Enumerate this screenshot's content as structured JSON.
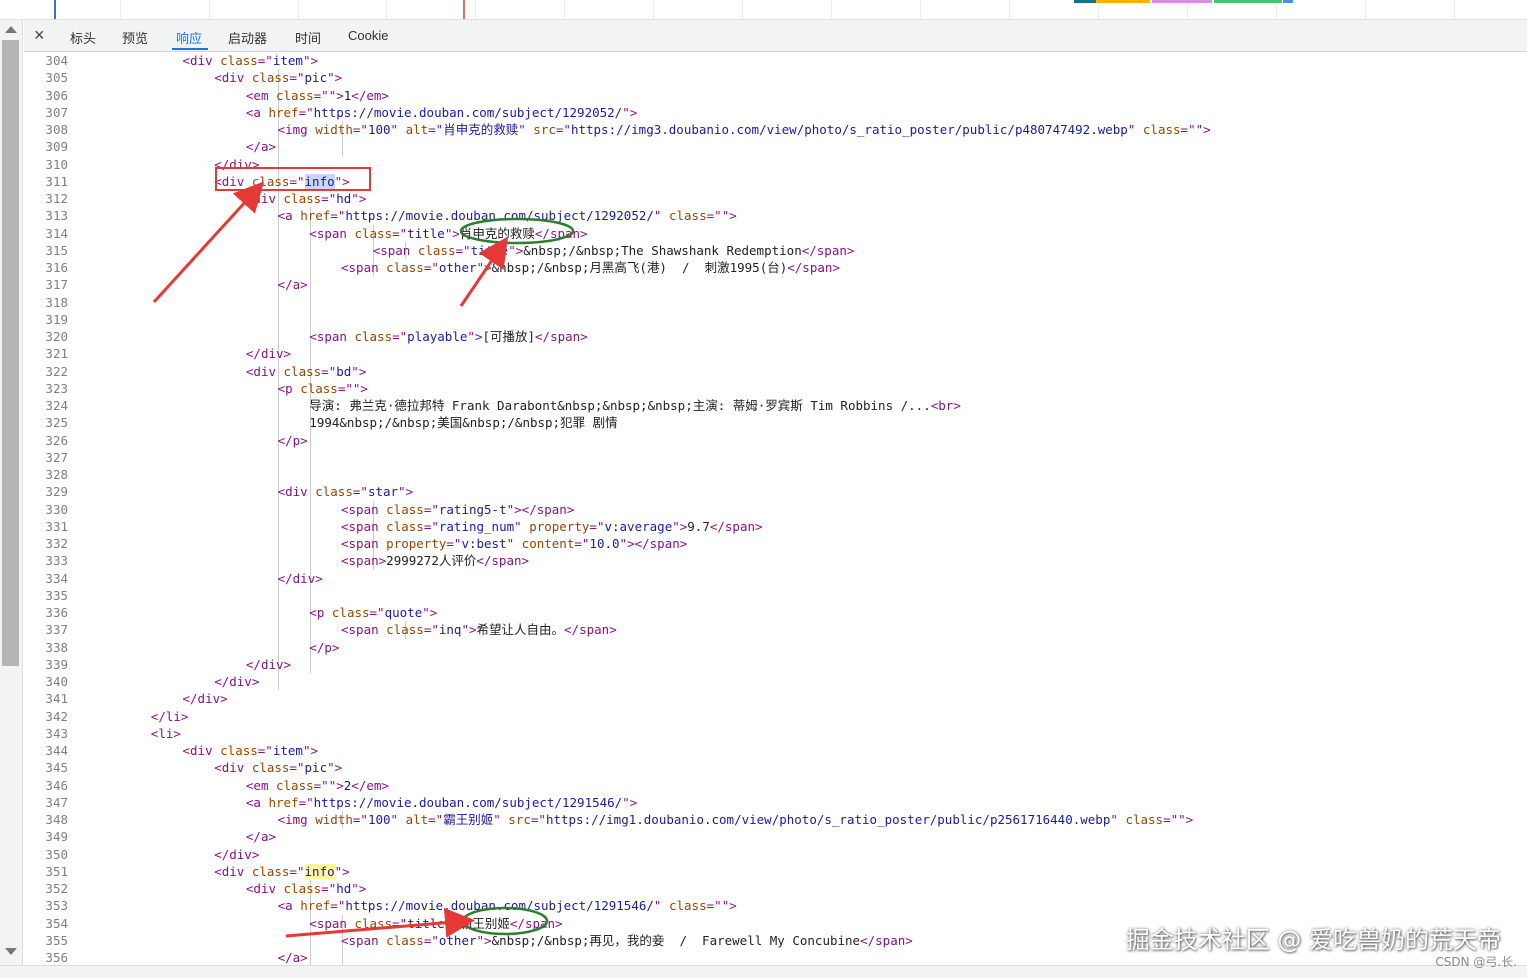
{
  "tabs": {
    "close_icon": "×",
    "items": [
      "标头",
      "预览",
      "响应",
      "启动器",
      "时间",
      "Cookie"
    ],
    "active_index": 2
  },
  "colors": {
    "tag": "#881280",
    "attr": "#994500",
    "value": "#1a1aa6",
    "text": "#222222",
    "annotation_red": "#e53935",
    "annotation_green": "#2e7d32"
  },
  "code_lines": [
    {
      "n": "304",
      "indent": 5,
      "code": "<div class=\"item\">"
    },
    {
      "n": "305",
      "indent": 6,
      "code": "<div class=\"pic\">"
    },
    {
      "n": "306",
      "indent": 7,
      "code": "<em class=\"\">1</em>"
    },
    {
      "n": "307",
      "indent": 7,
      "code": "<a href=\"https://movie.douban.com/subject/1292052/\">"
    },
    {
      "n": "308",
      "indent": 8,
      "code": "<img width=\"100\" alt=\"肖申克的救赎\" src=\"https://img3.doubanio.com/view/photo/s_ratio_poster/public/p480747492.webp\" class=\"\">"
    },
    {
      "n": "309",
      "indent": 7,
      "code": "</a>"
    },
    {
      "n": "310",
      "indent": 6,
      "code": "</div>"
    },
    {
      "n": "311",
      "indent": 6,
      "code": "<div class=\"info\">",
      "mark": "sel"
    },
    {
      "n": "312",
      "indent": 7,
      "code": "<div class=\"hd\">"
    },
    {
      "n": "313",
      "indent": 8,
      "code": "<a href=\"https://movie.douban.com/subject/1292052/\" class=\"\">"
    },
    {
      "n": "314",
      "indent": 9,
      "code": "<span class=\"title\">肖申克的救赎</span>"
    },
    {
      "n": "315",
      "indent": 11,
      "code": "<span class=\"title\">&nbsp;/&nbsp;The Shawshank Redemption</span>"
    },
    {
      "n": "316",
      "indent": 10,
      "code": "<span class=\"other\">&nbsp;/&nbsp;月黑高飞(港)  /  刺激1995(台)</span>"
    },
    {
      "n": "317",
      "indent": 8,
      "code": "</a>"
    },
    {
      "n": "318",
      "indent": 0,
      "code": ""
    },
    {
      "n": "319",
      "indent": 0,
      "code": ""
    },
    {
      "n": "320",
      "indent": 9,
      "code": "<span class=\"playable\">[可播放]</span>"
    },
    {
      "n": "321",
      "indent": 7,
      "code": "</div>"
    },
    {
      "n": "322",
      "indent": 7,
      "code": "<div class=\"bd\">"
    },
    {
      "n": "323",
      "indent": 8,
      "code": "<p class=\"\">"
    },
    {
      "n": "324",
      "indent": 9,
      "code": "导演: 弗兰克·德拉邦特 Frank Darabont&nbsp;&nbsp;&nbsp;主演: 蒂姆·罗宾斯 Tim Robbins /...<br>"
    },
    {
      "n": "325",
      "indent": 9,
      "code": "1994&nbsp;/&nbsp;美国&nbsp;/&nbsp;犯罪 剧情"
    },
    {
      "n": "326",
      "indent": 8,
      "code": "</p>"
    },
    {
      "n": "327",
      "indent": 0,
      "code": ""
    },
    {
      "n": "328",
      "indent": 0,
      "code": ""
    },
    {
      "n": "329",
      "indent": 8,
      "code": "<div class=\"star\">"
    },
    {
      "n": "330",
      "indent": 10,
      "code": "<span class=\"rating5-t\"></span>"
    },
    {
      "n": "331",
      "indent": 10,
      "code": "<span class=\"rating_num\" property=\"v:average\">9.7</span>"
    },
    {
      "n": "332",
      "indent": 10,
      "code": "<span property=\"v:best\" content=\"10.0\"></span>"
    },
    {
      "n": "333",
      "indent": 10,
      "code": "<span>2999272人评价</span>"
    },
    {
      "n": "334",
      "indent": 8,
      "code": "</div>"
    },
    {
      "n": "335",
      "indent": 0,
      "code": ""
    },
    {
      "n": "336",
      "indent": 9,
      "code": "<p class=\"quote\">"
    },
    {
      "n": "337",
      "indent": 10,
      "code": "<span class=\"inq\">希望让人自由。</span>"
    },
    {
      "n": "338",
      "indent": 9,
      "code": "</p>"
    },
    {
      "n": "339",
      "indent": 7,
      "code": "</div>"
    },
    {
      "n": "340",
      "indent": 6,
      "code": "</div>"
    },
    {
      "n": "341",
      "indent": 5,
      "code": "</div>"
    },
    {
      "n": "342",
      "indent": 4,
      "code": "</li>"
    },
    {
      "n": "343",
      "indent": 4,
      "code": "<li>"
    },
    {
      "n": "344",
      "indent": 5,
      "code": "<div class=\"item\">"
    },
    {
      "n": "345",
      "indent": 6,
      "code": "<div class=\"pic\">"
    },
    {
      "n": "346",
      "indent": 7,
      "code": "<em class=\"\">2</em>"
    },
    {
      "n": "347",
      "indent": 7,
      "code": "<a href=\"https://movie.douban.com/subject/1291546/\">"
    },
    {
      "n": "348",
      "indent": 8,
      "code": "<img width=\"100\" alt=\"霸王别姬\" src=\"https://img1.doubanio.com/view/photo/s_ratio_poster/public/p2561716440.webp\" class=\"\">"
    },
    {
      "n": "349",
      "indent": 7,
      "code": "</a>"
    },
    {
      "n": "350",
      "indent": 6,
      "code": "</div>"
    },
    {
      "n": "351",
      "indent": 6,
      "code": "<div class=\"info\">",
      "mark": "hl"
    },
    {
      "n": "352",
      "indent": 7,
      "code": "<div class=\"hd\">"
    },
    {
      "n": "353",
      "indent": 8,
      "code": "<a href=\"https://movie.douban.com/subject/1291546/\" class=\"\">"
    },
    {
      "n": "354",
      "indent": 9,
      "code": "<span class=\"title\">霸王别姬</span>"
    },
    {
      "n": "355",
      "indent": 10,
      "code": "<span class=\"other\">&nbsp;/&nbsp;再见，我的妾  /  Farewell My Concubine</span>"
    },
    {
      "n": "356",
      "indent": 8,
      "code": "</a>"
    }
  ],
  "watermark": {
    "main": "掘金技术社区 @ 爱吃兽奶的荒天帝",
    "small": "CSDN @弓.长."
  }
}
